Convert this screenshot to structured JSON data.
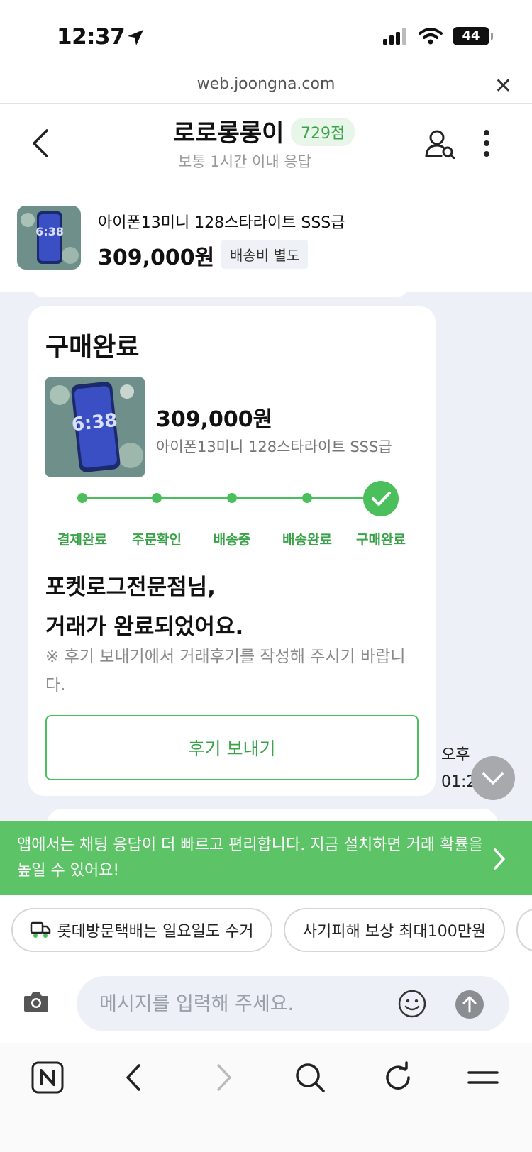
{
  "status_bar": {
    "time": "12:37",
    "battery": "44"
  },
  "browser": {
    "url": "web.joongna.com"
  },
  "header": {
    "seller_name": "로로롱롱이",
    "score": "729점",
    "response_time": "보통 1시간 이내 응답"
  },
  "product": {
    "title": "아이폰13미니 128스타라이트 SSS급",
    "price": "309,000원",
    "shipping_badge": "배송비 별도"
  },
  "purchase_card": {
    "title": "구매완료",
    "price": "309,000원",
    "product_name": "아이폰13미니 128스타라이트 SSS급",
    "steps": [
      "결제완료",
      "주문확인",
      "배송중",
      "배송완료",
      "구매완료"
    ],
    "current_step": 5,
    "message_line1": "포켓로그전문점님,",
    "message_line2": "거래가 완료되었어요.",
    "note": "※ 후기 보내기에서 거래후기를 작성해 주시기 바랍니다.",
    "review_button": "후기 보내기"
  },
  "message_time": {
    "line1": "오후",
    "line2": "01:2"
  },
  "app_banner": {
    "text": "앱에서는 채팅 응답이 더 빠르고 편리합니다. 지금 설치하면 거래 확률을 높일 수 있어요!"
  },
  "chips": [
    {
      "label": "롯데방문택배는 일요일도 수거"
    },
    {
      "label": "사기피해 보상 최대100만원"
    }
  ],
  "composer": {
    "placeholder": "메시지를 입력해 주세요."
  },
  "colors": {
    "accent_green": "#4bbf5c",
    "chat_bg": "#edf1f7",
    "banner_green": "#5cc466"
  }
}
